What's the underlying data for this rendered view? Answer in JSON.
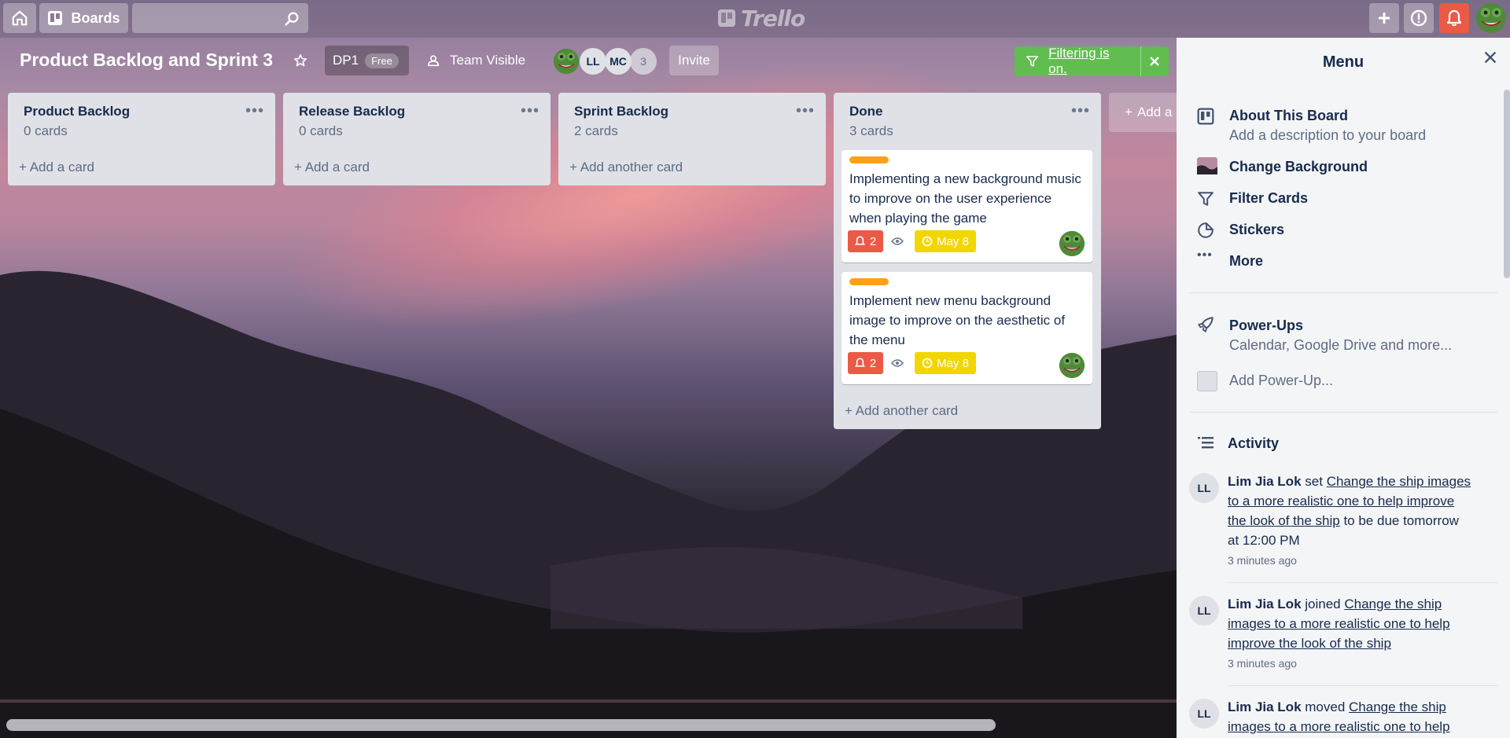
{
  "header": {
    "boards_label": "Boards",
    "search_placeholder": "",
    "logo_text": "Trello"
  },
  "board": {
    "title": "Product Backlog and Sprint 3",
    "team_name": "DP1",
    "plan_badge": "Free",
    "visibility": "Team Visible",
    "members": [
      "LL",
      "MC"
    ],
    "extra_members": "3",
    "invite_label": "Invite",
    "filter_text": "Filtering is on."
  },
  "lists": [
    {
      "title": "Product Backlog",
      "count": "0 cards",
      "add_label": "Add a card"
    },
    {
      "title": "Release Backlog",
      "count": "0 cards",
      "add_label": "Add a card"
    },
    {
      "title": "Sprint Backlog",
      "count": "2 cards",
      "add_label": "Add another card"
    },
    {
      "title": "Done",
      "count": "3 cards",
      "add_label": "Add another card",
      "cards": [
        {
          "text": "Implementing a new background music to improve on the user experience when playing the game",
          "notifications": "2",
          "due": "May 8"
        },
        {
          "text": "Implement new menu background image to improve on the aesthetic of the menu",
          "notifications": "2",
          "due": "May 8"
        }
      ]
    }
  ],
  "add_list_label": "Add a",
  "menu": {
    "title": "Menu",
    "about_title": "About This Board",
    "about_sub": "Add a description to your board",
    "change_bg": "Change Background",
    "filter_cards": "Filter Cards",
    "stickers": "Stickers",
    "more": "More",
    "powerups_title": "Power-Ups",
    "powerups_sub": "Calendar, Google Drive and more...",
    "add_powerup": "Add Power-Up...",
    "activity_title": "Activity",
    "activities": [
      {
        "avatar": "LL",
        "user": "Lim Jia Lok",
        "action": "set",
        "link": "Change the ship images to a more realistic one to help improve the look of the ship",
        "suffix": "to be due tomorrow at 12:00 PM",
        "time": "3 minutes ago"
      },
      {
        "avatar": "LL",
        "user": "Lim Jia Lok",
        "action": "joined",
        "link": "Change the ship images to a more realistic one to help improve the look of the ship",
        "suffix": "",
        "time": "3 minutes ago"
      },
      {
        "avatar": "LL",
        "user": "Lim Jia Lok",
        "action": "moved",
        "link": "Change the ship images to a more realistic one to help",
        "suffix": "",
        "time": ""
      }
    ]
  },
  "colors": {
    "filter_green": "#61bd4f",
    "label_orange": "#ff9f1a",
    "badge_red": "#eb5a46",
    "due_yellow": "#f2d600",
    "notification_red": "#eb5a46"
  }
}
